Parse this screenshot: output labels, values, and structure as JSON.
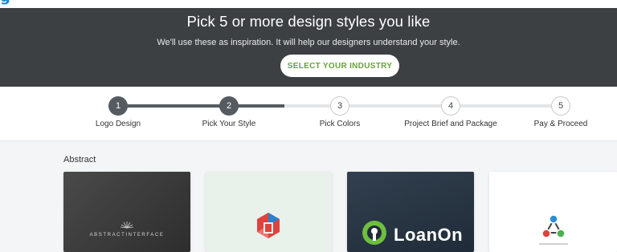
{
  "hero": {
    "title": "Pick 5 or more design styles you like",
    "subtitle": "We'll use these as inspiration. It will help our designers understand your style.",
    "industry_button": "SELECT YOUR INDUSTRY"
  },
  "steps": [
    {
      "number": "1",
      "label": "Logo Design",
      "status": "completed"
    },
    {
      "number": "2",
      "label": "Pick Your Style",
      "status": "current"
    },
    {
      "number": "3",
      "label": "Pick Colors",
      "status": "upcoming"
    },
    {
      "number": "4",
      "label": "Project Brief and Package",
      "status": "upcoming"
    },
    {
      "number": "5",
      "label": "Pay & Proceed",
      "status": "upcoming"
    }
  ],
  "gallery": {
    "section_title": "Abstract",
    "cards": [
      {
        "brand": "ABSTRACTINTERFACE"
      },
      {
        "brand": ""
      },
      {
        "brand": "LoanOn"
      },
      {
        "brand": ""
      }
    ]
  },
  "colors": {
    "hero_bg": "#3c4043",
    "accent_green": "#66a33a",
    "step_active": "#555b60",
    "logo_blue": "#1a88d6"
  },
  "icons": {
    "card2_logo": "red-blue-gem-icon",
    "card3_logo": "green-keyhole-leaf-icon",
    "card4_logo": "connected-nodes-icon",
    "card1_logo": "sunburst-icon"
  }
}
